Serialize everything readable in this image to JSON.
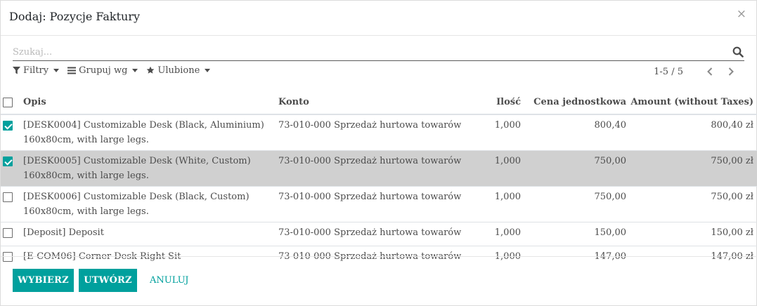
{
  "dialog": {
    "title": "Dodaj: Pozycje Faktury",
    "close_glyph": "×"
  },
  "search": {
    "placeholder": "Szukaj...",
    "icon": "search-icon"
  },
  "filters": {
    "filter_label": "Filtry",
    "group_label": "Grupuj wg",
    "favorites_label": "Ulubione"
  },
  "pager": {
    "value": "1-5 / 5"
  },
  "table": {
    "columns": {
      "description": "Opis",
      "account": "Konto",
      "quantity": "Ilość",
      "unit_price": "Cena jednostkowa",
      "amount": "Amount (without Taxes)"
    },
    "rows": [
      {
        "checked": true,
        "desc1": "[DESK0004] Customizable Desk (Black, Aluminium)",
        "desc2": "160x80cm, with large legs.",
        "account": "73-010-000 Sprzedaż hurtowa towarów",
        "quantity": "1,000",
        "unit_price": "800,40",
        "amount": "800,40 zł"
      },
      {
        "checked": true,
        "desc1": "[DESK0005] Customizable Desk (White, Custom)",
        "desc2": "160x80cm, with large legs.",
        "account": "73-010-000 Sprzedaż hurtowa towarów",
        "quantity": "1,000",
        "unit_price": "750,00",
        "amount": "750,00 zł"
      },
      {
        "checked": false,
        "desc1": "[DESK0006] Customizable Desk (Black, Custom)",
        "desc2": "160x80cm, with large legs.",
        "account": "73-010-000 Sprzedaż hurtowa towarów",
        "quantity": "1,000",
        "unit_price": "750,00",
        "amount": "750,00 zł"
      },
      {
        "checked": false,
        "desc1": "[Deposit] Deposit",
        "account": "73-010-000 Sprzedaż hurtowa towarów",
        "quantity": "1,000",
        "unit_price": "150,00",
        "amount": "150,00 zł"
      },
      {
        "checked": false,
        "desc1": "[E-COM06] Corner Desk Right Sit",
        "account": "73-010-000 Sprzedaż hurtowa towarów",
        "quantity": "1,000",
        "unit_price": "147,00",
        "amount": "147,00 zł"
      }
    ]
  },
  "footer": {
    "select_label": "WYBIERZ",
    "create_label": "UTWÓRZ",
    "cancel_label": "ANULUJ"
  },
  "colors": {
    "accent": "#00a09d",
    "selected_row": "#d0d0d0"
  }
}
